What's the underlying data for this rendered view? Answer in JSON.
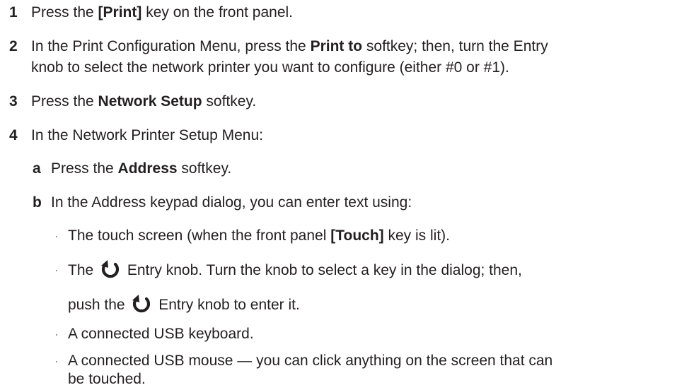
{
  "steps": [
    {
      "num": "1",
      "pre": "Press the ",
      "key": "[Print]",
      "post": " key on the front panel."
    },
    {
      "num": "2",
      "pre": "In the Print Configuration Menu, press the ",
      "key": "Print to",
      "post": " softkey; then, turn the Entry",
      "cont": "knob to select the network printer you want to configure (either #0 or #1)."
    },
    {
      "num": "3",
      "pre": "Press the ",
      "key": "Network Setup",
      "post": " softkey."
    },
    {
      "num": "4",
      "text": "In the Network Printer Setup Menu:"
    }
  ],
  "substeps": [
    {
      "letter": "a",
      "pre": "Press the ",
      "key": "Address",
      "post": " softkey."
    },
    {
      "letter": "b",
      "text": "In the Address keypad dialog, you can enter text using:"
    }
  ],
  "bullets": [
    {
      "pre": "The touch screen (when the front panel ",
      "key": "[Touch]",
      "post": " key is lit)."
    },
    {
      "pre": "The ",
      "icon": "entry-knob-icon",
      "post": " Entry knob. Turn the knob to select a key in the dialog; then,",
      "cont_pre": "push the ",
      "cont_post": " Entry knob to enter it."
    },
    {
      "text": "A connected USB keyboard."
    },
    {
      "text": "A connected USB mouse — you can click anything on the screen that can",
      "cont": "be touched."
    }
  ],
  "bullet_symbol": "·"
}
